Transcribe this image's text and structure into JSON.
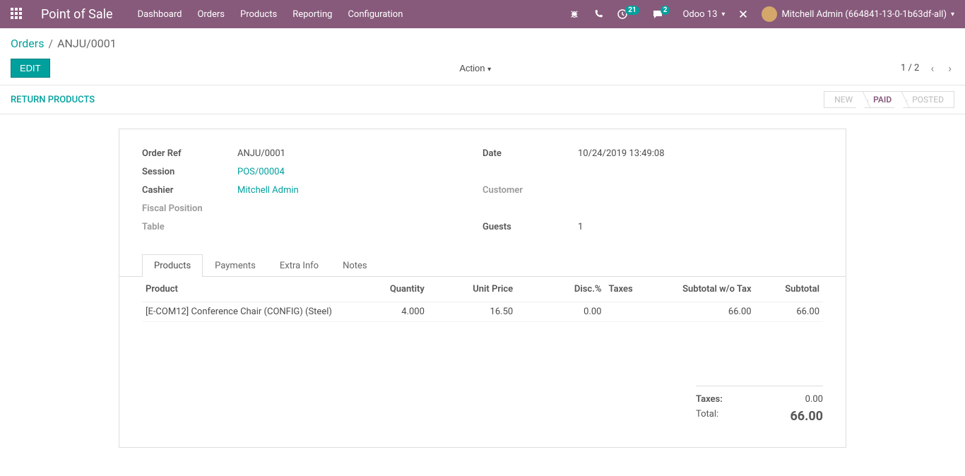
{
  "navbar": {
    "brand": "Point of Sale",
    "menu": [
      "Dashboard",
      "Orders",
      "Products",
      "Reporting",
      "Configuration"
    ],
    "activity_count": "21",
    "chat_count": "2",
    "db_label": "Odoo 13",
    "user_label": "Mitchell Admin (664841-13-0-1b63df-all)"
  },
  "breadcrumb": {
    "parent": "Orders",
    "current": "ANJU/0001"
  },
  "toolbar": {
    "edit_label": "EDIT",
    "action_label": "Action",
    "pager": "1 / 2"
  },
  "statusbar": {
    "return_label": "RETURN PRODUCTS",
    "steps": [
      "NEW",
      "PAID",
      "POSTED"
    ],
    "active_index": 1
  },
  "form": {
    "left": {
      "order_ref_label": "Order Ref",
      "order_ref": "ANJU/0001",
      "session_label": "Session",
      "session": "POS/00004",
      "cashier_label": "Cashier",
      "cashier": "Mitchell Admin",
      "fiscal_label": "Fiscal Position",
      "table_label": "Table"
    },
    "right": {
      "date_label": "Date",
      "date": "10/24/2019 13:49:08",
      "customer_label": "Customer",
      "guests_label": "Guests",
      "guests": "1"
    }
  },
  "tabs": {
    "items": [
      "Products",
      "Payments",
      "Extra Info",
      "Notes"
    ]
  },
  "table": {
    "headers": {
      "product": "Product",
      "quantity": "Quantity",
      "unit_price": "Unit Price",
      "disc": "Disc.%",
      "taxes": "Taxes",
      "subtotal_wo": "Subtotal w/o Tax",
      "subtotal": "Subtotal"
    },
    "rows": [
      {
        "product": "[E-COM12] Conference Chair (CONFIG) (Steel)",
        "quantity": "4.000",
        "unit_price": "16.50",
        "disc": "0.00",
        "taxes": "",
        "subtotal_wo": "66.00",
        "subtotal": "66.00"
      }
    ]
  },
  "totals": {
    "taxes_label": "Taxes:",
    "taxes": "0.00",
    "total_label": "Total:",
    "total": "66.00"
  }
}
